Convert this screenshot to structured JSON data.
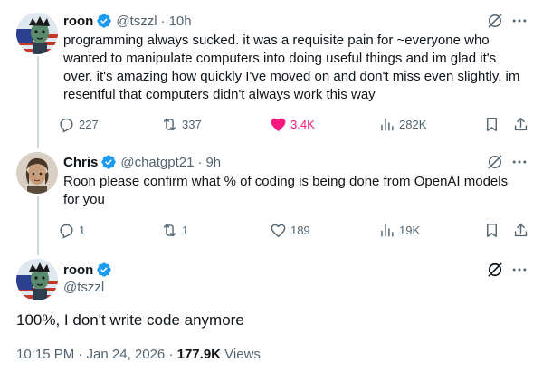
{
  "tweets": [
    {
      "name": "roon",
      "handle": "@tszzl",
      "time": "10h",
      "text": "programming always sucked. it was a requisite pain for ~everyone who wanted to manipulate computers into doing useful things and im glad it's over. it's amazing how quickly I've moved on and don't miss even slightly. im resentful that computers didn't always work this way",
      "replies": "227",
      "reposts": "337",
      "likes": "3.4K",
      "views": "282K"
    },
    {
      "name": "Chris",
      "handle": "@chatgpt21",
      "time": "9h",
      "text": "Roon please confirm what % of coding is being done from OpenAI models for you",
      "replies": "1",
      "reposts": "1",
      "likes": "189",
      "views": "19K"
    }
  ],
  "main_tweet": {
    "name": "roon",
    "handle": "@tszzl",
    "text": "100%, I don't write code anymore",
    "timestamp": "10:15 PM · Jan 24, 2026",
    "view_count": "177.9K",
    "views_label": "Views"
  },
  "separator": "·",
  "colors": {
    "accent": "#1d9bf0",
    "like": "#f91880",
    "secondary_text": "#536471",
    "primary_text": "#0f1419",
    "thread_line": "#cfd9de"
  },
  "icons": [
    "verified-badge-icon",
    "grok-icon",
    "more-icon",
    "reply-icon",
    "repost-icon",
    "like-icon",
    "views-icon",
    "bookmark-icon",
    "share-icon"
  ]
}
